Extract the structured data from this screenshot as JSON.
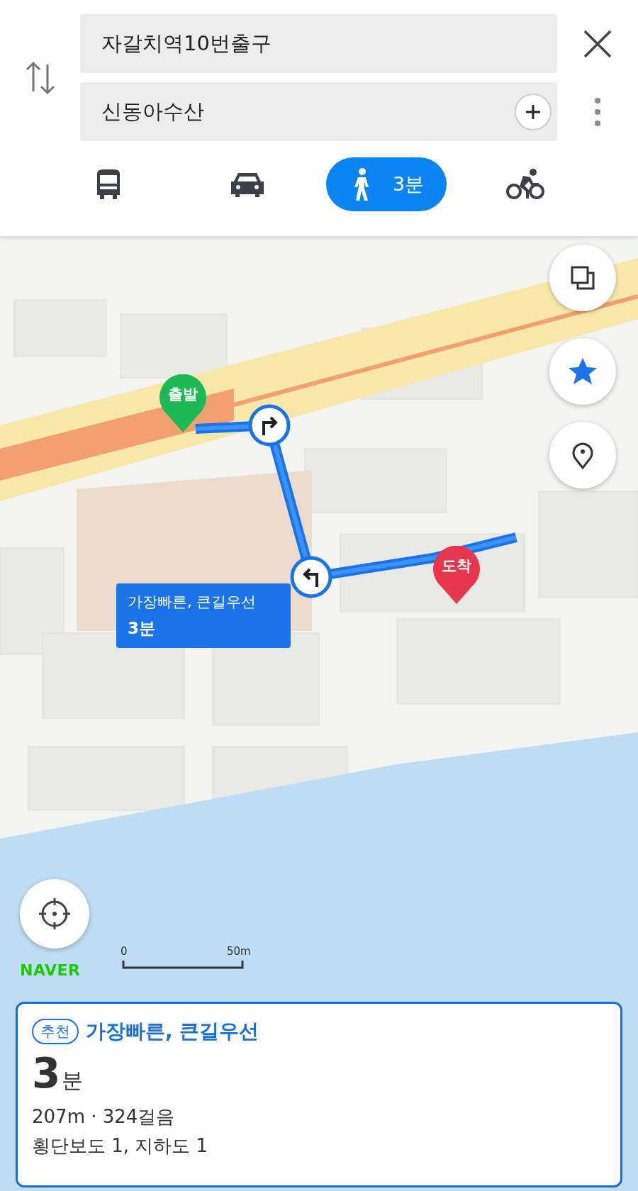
{
  "route_inputs": {
    "origin": "자갈치역10번출구",
    "destination": "신동아수산"
  },
  "modes": [
    {
      "kind": "bus",
      "selected": false
    },
    {
      "kind": "car",
      "selected": false
    },
    {
      "kind": "walk",
      "selected": true,
      "time": "3분"
    },
    {
      "kind": "bike",
      "selected": false
    }
  ],
  "map": {
    "kind": "picture",
    "pins": [
      {
        "kind": "start",
        "label": "출발"
      },
      {
        "kind": "end",
        "label": "도착"
      }
    ],
    "callout": {
      "title": "가장빠른, 큰길우선",
      "time": "3분"
    },
    "logo": "NAVER",
    "scale": {
      "start": "0",
      "end": "50m"
    }
  },
  "route_card": {
    "badge": "추천",
    "title": "가장빠른, 큰길우선",
    "time_value": "3",
    "time_unit": "분",
    "distance_steps": "207m · 324걸음",
    "crossings": "횡단보도 1, 지하도 1"
  }
}
